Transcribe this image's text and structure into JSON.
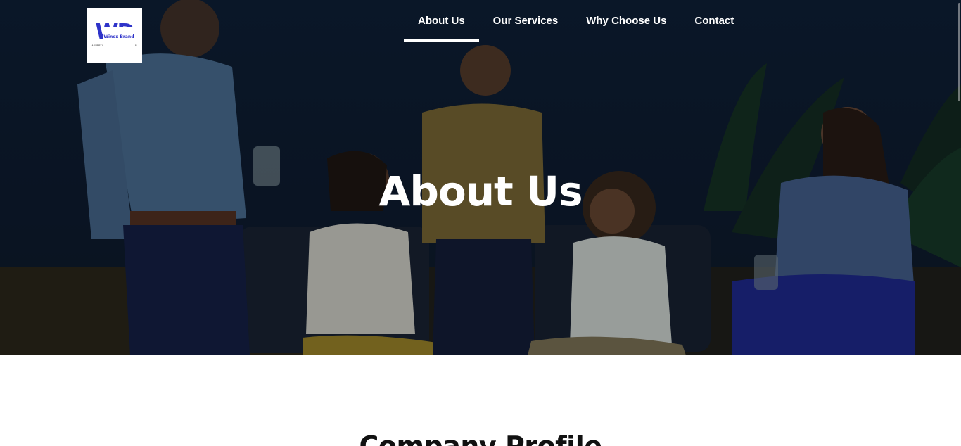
{
  "header": {
    "logo": {
      "mark": "WD",
      "brand": "Winex Brand",
      "tagline": "ADVERTISING & MARKETING DESIGN"
    },
    "nav": [
      {
        "label": "About Us",
        "active": true
      },
      {
        "label": "Our Services",
        "active": false
      },
      {
        "label": "Why Choose Us",
        "active": false
      },
      {
        "label": "Contact",
        "active": false
      }
    ]
  },
  "hero": {
    "title": "About Us"
  },
  "section": {
    "title": "Company Profile"
  },
  "colors": {
    "brand": "#2e33c9",
    "hero_bg": "#0c1a2c",
    "text_light": "#ffffff",
    "text_dark": "#111111"
  }
}
